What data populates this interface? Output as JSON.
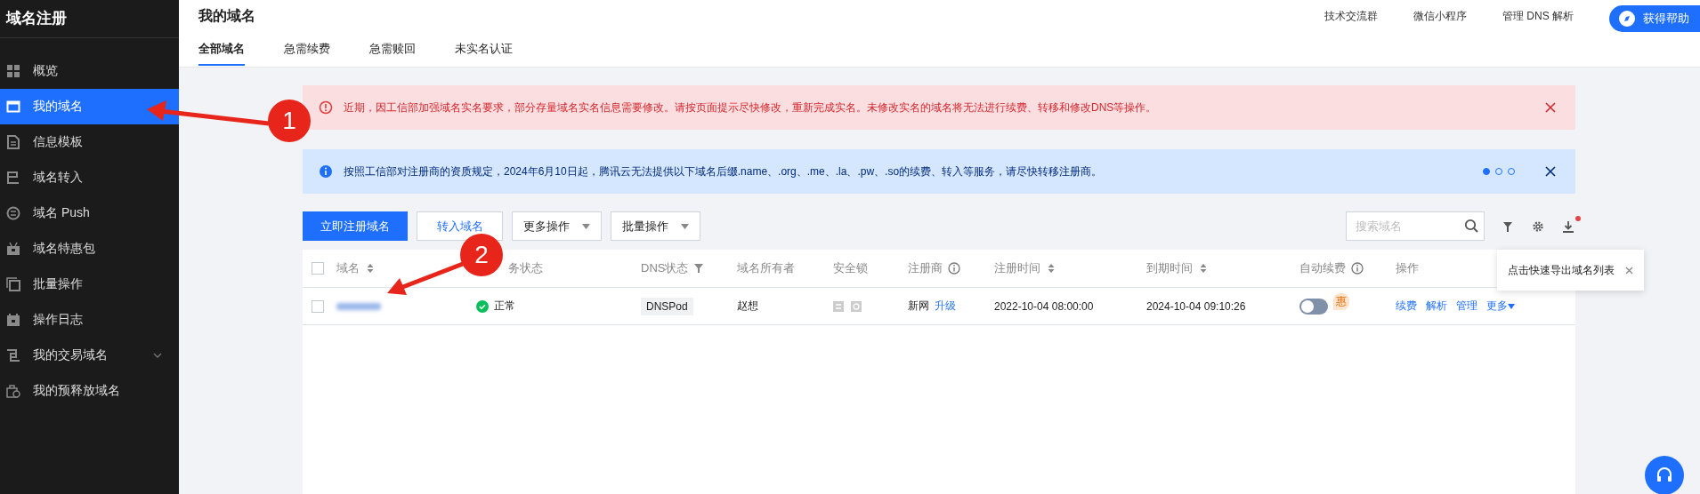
{
  "sidebar": {
    "title": "域名注册",
    "items": [
      {
        "label": "概览",
        "kind": "link",
        "selected": false
      },
      {
        "label": "我的域名",
        "kind": "link",
        "selected": true
      },
      {
        "label": "信息模板",
        "kind": "link",
        "selected": false
      },
      {
        "label": "域名转入",
        "kind": "link",
        "selected": false
      },
      {
        "label": "域名 Push",
        "kind": "link",
        "selected": false
      },
      {
        "label": "域名特惠包",
        "kind": "link",
        "selected": false
      },
      {
        "label": "批量操作",
        "kind": "link",
        "selected": false
      },
      {
        "label": "操作日志",
        "kind": "link",
        "selected": false
      },
      {
        "label": "我的交易域名",
        "kind": "group",
        "selected": false
      },
      {
        "label": "我的预释放域名",
        "kind": "link",
        "selected": false
      }
    ]
  },
  "header": {
    "title": "我的域名",
    "links": [
      "技术交流群",
      "微信小程序",
      "管理 DNS 解析"
    ],
    "help_button": "获得帮助",
    "tabs": [
      {
        "label": "全部域名",
        "selected": true
      },
      {
        "label": "急需续费",
        "selected": false
      },
      {
        "label": "急需赎回",
        "selected": false
      },
      {
        "label": "未实名认证",
        "selected": false
      }
    ]
  },
  "alerts": [
    {
      "kind": "error",
      "text": "近期，因工信部加强域名实名要求，部分存量域名实名信息需要修改。请按页面提示尽快修改，重新完成实名。未修改实名的域名将无法进行续费、转移和修改DNS等操作。"
    },
    {
      "kind": "info",
      "text": "按照工信部对注册商的资质规定，2024年6月10日起，腾讯云无法提供以下域名后缀.name、.org、.me、.la、.pw、.so的续费、转入等服务，请尽快转移注册商。",
      "pager": [
        {
          "selected": true
        },
        {
          "selected": false
        },
        {
          "selected": false
        }
      ]
    }
  ],
  "toolbar": {
    "buttons": [
      {
        "label": "立即注册域名",
        "kind": "primary"
      },
      {
        "label": "转入域名",
        "kind": "link"
      },
      {
        "label": "更多操作",
        "kind": "dropdown"
      },
      {
        "label": "批量操作",
        "kind": "dropdown"
      }
    ],
    "search": {
      "placeholder": "搜索域名"
    },
    "export_badge": true,
    "tooltip": "点击快速导出域名列表"
  },
  "table": {
    "header_checked": false,
    "columns": [
      {
        "label": "域名",
        "kind": "sort"
      },
      {
        "label": "务状态",
        "kind": "plain"
      },
      {
        "label": "DNS状态",
        "kind": "filter"
      },
      {
        "label": "域名所有者",
        "kind": "plain"
      },
      {
        "label": "安全锁",
        "kind": "plain"
      },
      {
        "label": "注册商",
        "kind": "info"
      },
      {
        "label": "注册时间",
        "kind": "sort"
      },
      {
        "label": "到期时间",
        "kind": "sort"
      },
      {
        "label": "自动续费",
        "kind": "info"
      },
      {
        "label": "操作",
        "kind": "plain"
      }
    ],
    "rows": [
      {
        "checked": false,
        "status": "正常",
        "dns": "DNSPod",
        "owner": "赵想",
        "registrar": "新网",
        "registrar_link": "升级",
        "registered": "2022-10-04 08:00:00",
        "expires": "2024-10-04 09:10:26",
        "auto_renew": false,
        "discount_badge": "惠",
        "actions": [
          {
            "label": "续费",
            "kind": "link"
          },
          {
            "label": "解析",
            "kind": "link"
          },
          {
            "label": "管理",
            "kind": "link"
          },
          {
            "label": "更多",
            "kind": "menu"
          }
        ]
      }
    ]
  },
  "annotations": [
    {
      "label": "1"
    },
    {
      "label": "2"
    }
  ]
}
